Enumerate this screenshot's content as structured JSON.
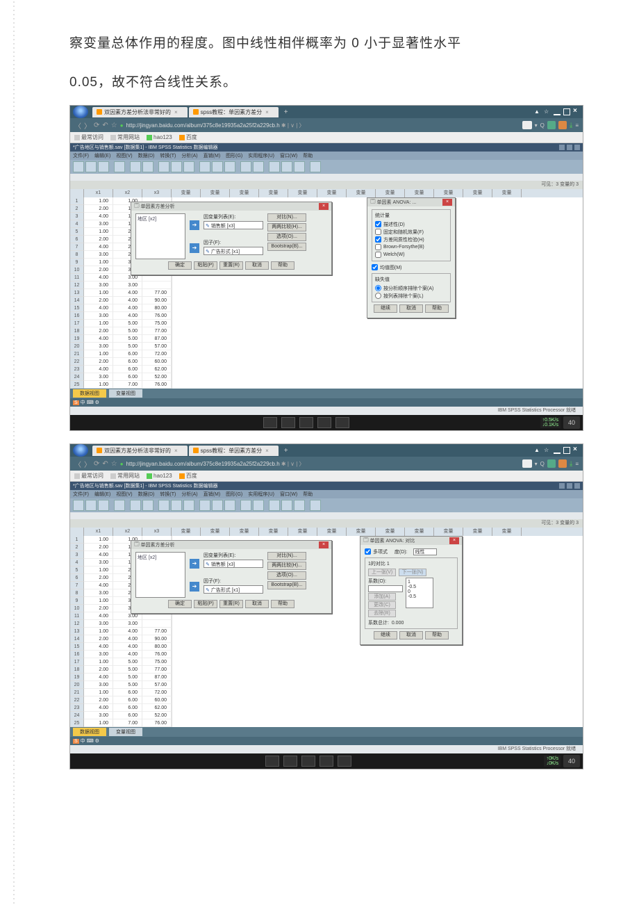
{
  "body_text": {
    "line1": "察变量总体作用的程度。图中线性相伴概率为 0 小于显著性水平",
    "line2": "0.05，故不符合线性关系。"
  },
  "browser": {
    "tab1": "双因素方差分析法非常好的",
    "tab2": "spss教程：单因素方差分",
    "url": "http://jingyan.baidu.com/album/375c8e19935a2a25f2a229cb.h",
    "bookmarks_label": "最常访问",
    "bm1": "常用网站",
    "bm2": "hao123",
    "bm3": "百度"
  },
  "spss": {
    "title1": "*广告地区与销售额.sav [数据集1] - IBM SPSS Statistics 数据编辑器",
    "menu": [
      "文件(F)",
      "编辑(E)",
      "视图(V)",
      "数据(D)",
      "转换(T)",
      "分析(A)",
      "直销(M)",
      "图形(G)",
      "实用程序(U)",
      "窗口(W)",
      "帮助"
    ],
    "cols": [
      "x1",
      "x2",
      "x3",
      "变量",
      "变量",
      "变量",
      "变量",
      "变量",
      "变量",
      "变量",
      "变量",
      "变量",
      "变量",
      "变量",
      "变量"
    ],
    "corner_label": "可见：3 变量的 3",
    "status": "IBM SPSS Statistics Processor 就绪",
    "tabs": {
      "data": "数据视图",
      "var": "变量视图"
    }
  },
  "data_rows": [
    {
      "n": 1,
      "x1": "1.00",
      "x2": "1.00",
      "x3": ""
    },
    {
      "n": 2,
      "x1": "2.00",
      "x2": "1.00",
      "x3": ""
    },
    {
      "n": 3,
      "x1": "4.00",
      "x2": "1.00",
      "x3": ""
    },
    {
      "n": 4,
      "x1": "3.00",
      "x2": "1.00",
      "x3": ""
    },
    {
      "n": 5,
      "x1": "1.00",
      "x2": "2.00",
      "x3": ""
    },
    {
      "n": 6,
      "x1": "2.00",
      "x2": "2.00",
      "x3": ""
    },
    {
      "n": 7,
      "x1": "4.00",
      "x2": "2.00",
      "x3": ""
    },
    {
      "n": 8,
      "x1": "3.00",
      "x2": "2.00",
      "x3": ""
    },
    {
      "n": 9,
      "x1": "1.00",
      "x2": "3.00",
      "x3": ""
    },
    {
      "n": 10,
      "x1": "2.00",
      "x2": "3.00",
      "x3": ""
    },
    {
      "n": 11,
      "x1": "4.00",
      "x2": "3.00",
      "x3": ""
    },
    {
      "n": 12,
      "x1": "3.00",
      "x2": "3.00",
      "x3": ""
    },
    {
      "n": 13,
      "x1": "1.00",
      "x2": "4.00",
      "x3": "77.00"
    },
    {
      "n": 14,
      "x1": "2.00",
      "x2": "4.00",
      "x3": "90.00"
    },
    {
      "n": 15,
      "x1": "4.00",
      "x2": "4.00",
      "x3": "80.00"
    },
    {
      "n": 16,
      "x1": "3.00",
      "x2": "4.00",
      "x3": "76.00"
    },
    {
      "n": 17,
      "x1": "1.00",
      "x2": "5.00",
      "x3": "75.00"
    },
    {
      "n": 18,
      "x1": "2.00",
      "x2": "5.00",
      "x3": "77.00"
    },
    {
      "n": 19,
      "x1": "4.00",
      "x2": "5.00",
      "x3": "87.00"
    },
    {
      "n": 20,
      "x1": "3.00",
      "x2": "5.00",
      "x3": "57.00"
    },
    {
      "n": 21,
      "x1": "1.00",
      "x2": "6.00",
      "x3": "72.00"
    },
    {
      "n": 22,
      "x1": "2.00",
      "x2": "6.00",
      "x3": "60.00"
    },
    {
      "n": 23,
      "x1": "4.00",
      "x2": "6.00",
      "x3": "62.00"
    },
    {
      "n": 24,
      "x1": "3.00",
      "x2": "6.00",
      "x3": "52.00"
    },
    {
      "n": 25,
      "x1": "1.00",
      "x2": "7.00",
      "x3": "76.00"
    }
  ],
  "dlg_anova": {
    "title": "单因素方差分析",
    "region_item": "地区 [x2]",
    "dep_label": "因变量列表(E):",
    "dep_item": "销售额 [x3]",
    "factor_label": "因子(F):",
    "factor_item": "广告形式 [x1]",
    "side": {
      "contrast": "对比(N)...",
      "post": "两两比较(H)...",
      "options": "选项(O)...",
      "boot": "Bootstrap(B)..."
    },
    "buttons": {
      "ok": "确定",
      "paste": "粘贴(P)",
      "reset": "重置(R)",
      "cancel": "取消",
      "help": "帮助"
    }
  },
  "dlg_options": {
    "title": "单因素 ANOVA: ...",
    "stats_group": "统计量",
    "descr": "描述性(D)",
    "fixed": "固定和随机效果(F)",
    "homog": "方差同质性检验(H)",
    "brown": "Brown-Forsythe(B)",
    "welch": "Welch(W)",
    "means_plot": "均值图(M)",
    "miss_group": "缺失值",
    "miss1": "按分析顺序排除个案(A)",
    "miss2": "按列表排除个案(L)",
    "buttons": {
      "cont": "继续",
      "cancel": "取消",
      "help": "帮助"
    }
  },
  "dlg_contrast": {
    "title": "单因素 ANOVA: 对比",
    "poly": "多项式",
    "degree_lbl": "度(D):",
    "degree_val": "线性",
    "contrast_of": "1的对比 1",
    "prev": "上一张(V)",
    "next": "下一张(N)",
    "coef_lbl": "系数(O):",
    "add": "添加(A)",
    "change": "更改(C)",
    "去除": "去除(R)",
    "coefs": [
      "1",
      "-0.5",
      "0",
      "-0.5"
    ],
    "total_lbl": "系数总计:",
    "total_val": "0.000",
    "buttons": {
      "cont": "继续",
      "cancel": "取消",
      "help": "帮助"
    }
  },
  "net": {
    "up": "0.5K/s",
    "dn": "0.1K/s",
    "up2": "0K/s",
    "dn2": "0K/s"
  },
  "clock": "40"
}
